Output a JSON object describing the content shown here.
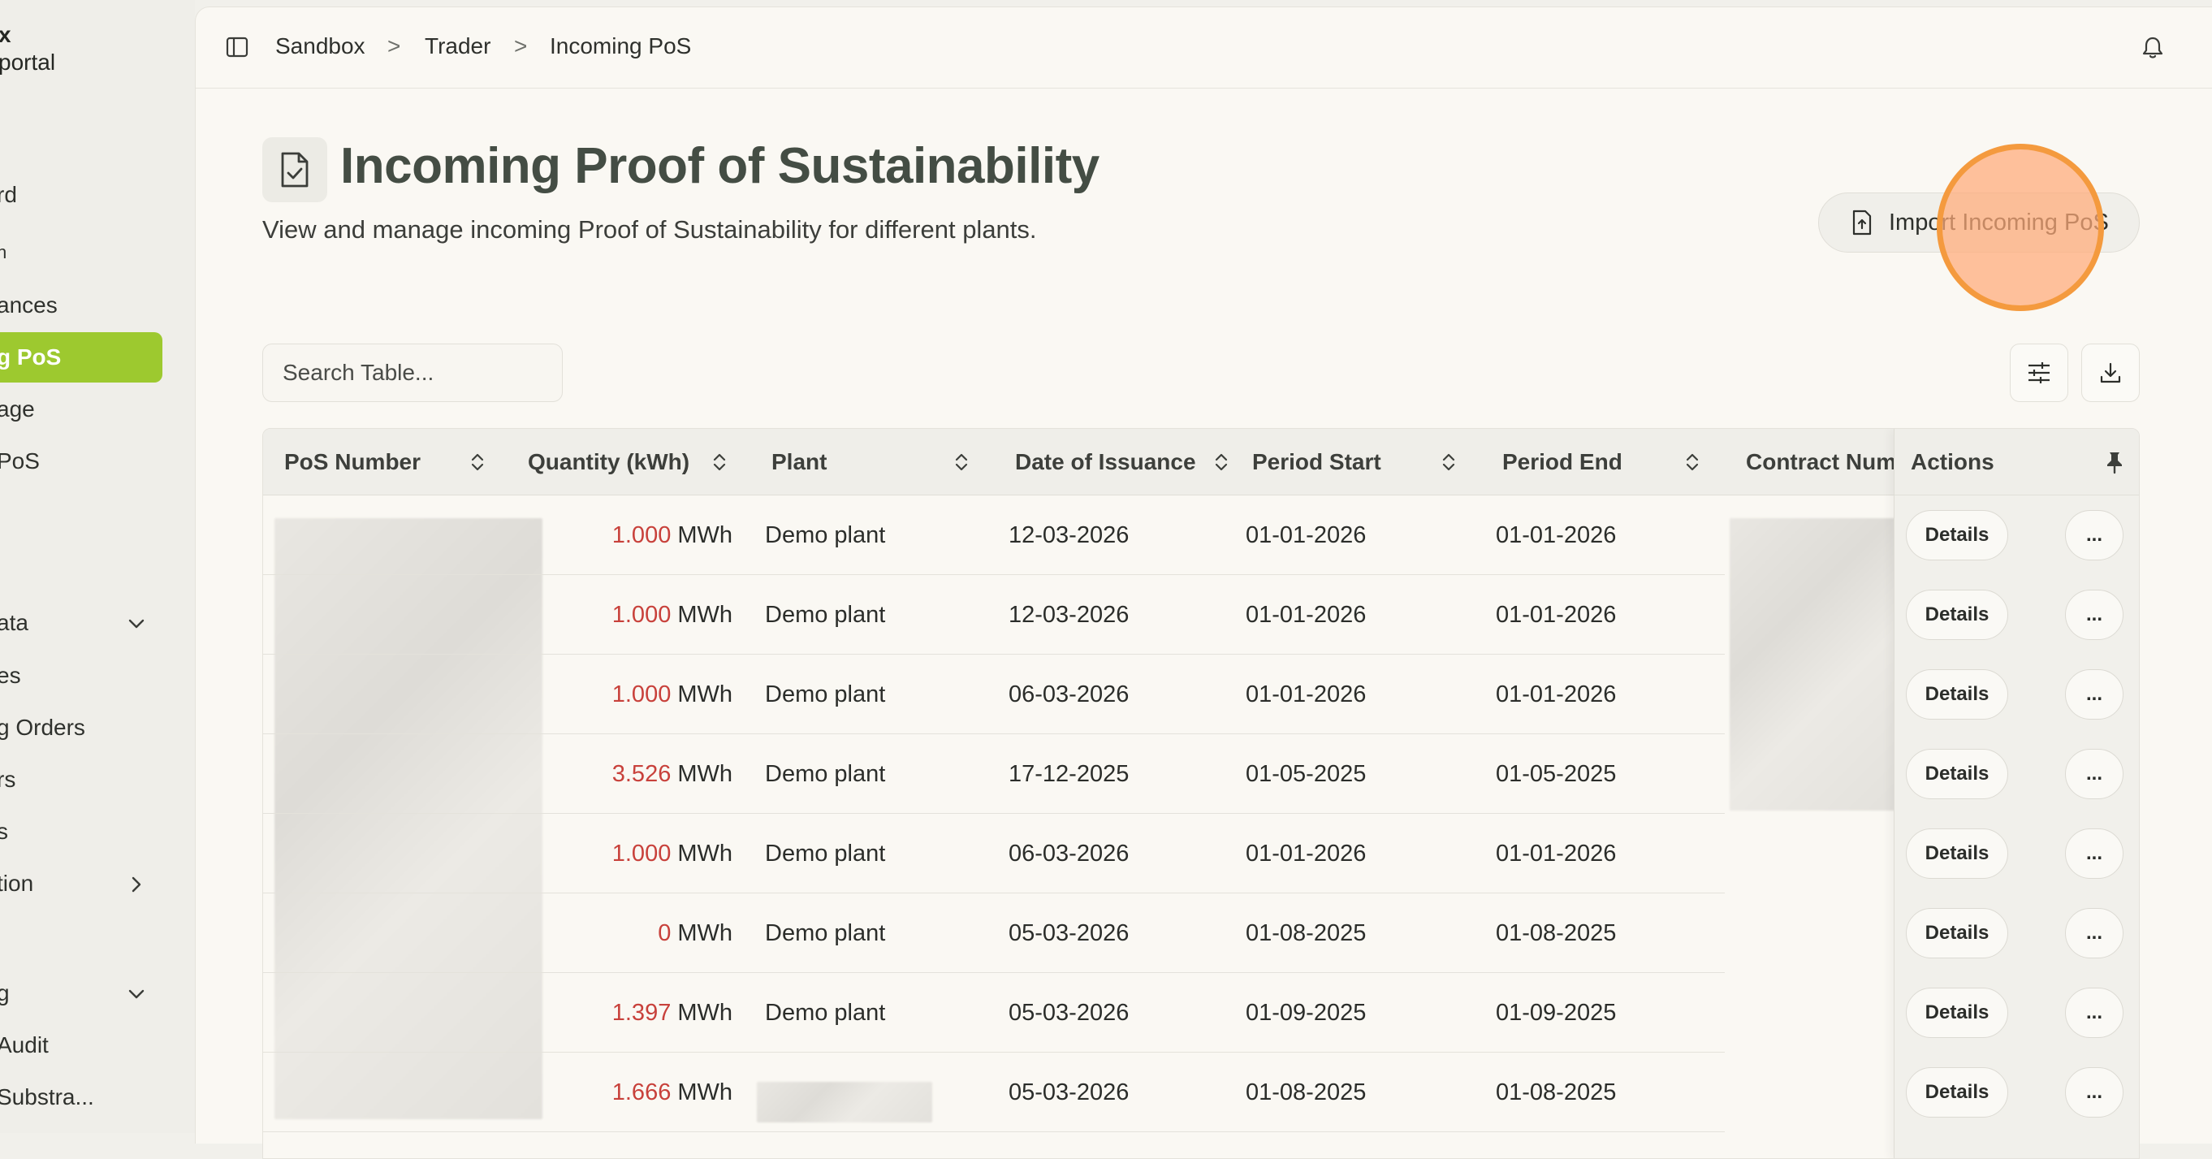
{
  "sidebar": {
    "brand_line1": "x",
    "brand_line2": "portal",
    "items": [
      {
        "label": "rd"
      },
      {
        "label": "n"
      },
      {
        "label": "ances"
      },
      {
        "label": "g PoS",
        "active": true
      },
      {
        "label": "age"
      },
      {
        "label": " PoS"
      },
      {
        "label": "ata"
      },
      {
        "label": "es"
      },
      {
        "label": "g Orders"
      },
      {
        "label": "rs"
      },
      {
        "label": "s"
      },
      {
        "label": "tion"
      },
      {
        "label": "g"
      },
      {
        "label": "Audit"
      },
      {
        "label": " Substra..."
      }
    ]
  },
  "breadcrumb": {
    "items": [
      "Sandbox",
      "Trader",
      "Incoming PoS"
    ],
    "separator": ">"
  },
  "header": {
    "title": "Incoming Proof of Sustainability",
    "subtitle": "View and manage incoming Proof of Sustainability for different plants.",
    "import_label": "Import Incoming PoS"
  },
  "search": {
    "placeholder": "Search Table..."
  },
  "table": {
    "columns": [
      "PoS Number",
      "Quantity (kWh)",
      "Plant",
      "Date of Issuance",
      "Period Start",
      "Period End",
      "Contract Num",
      "Actions"
    ],
    "unit": "MWh",
    "details_label": "Details",
    "more_label": "...",
    "rows": [
      {
        "quantity": "1.000",
        "plant": "Demo plant",
        "issued": "12-03-2026",
        "start": "01-01-2026",
        "end": "01-01-2026"
      },
      {
        "quantity": "1.000",
        "plant": "Demo plant",
        "issued": "12-03-2026",
        "start": "01-01-2026",
        "end": "01-01-2026"
      },
      {
        "quantity": "1.000",
        "plant": "Demo plant",
        "issued": "06-03-2026",
        "start": "01-01-2026",
        "end": "01-01-2026"
      },
      {
        "quantity": "3.526",
        "plant": "Demo plant",
        "issued": "17-12-2025",
        "start": "01-05-2025",
        "end": "01-05-2025"
      },
      {
        "quantity": "1.000",
        "plant": "Demo plant",
        "issued": "06-03-2026",
        "start": "01-01-2026",
        "end": "01-01-2026"
      },
      {
        "quantity": "0",
        "plant": "Demo plant",
        "issued": "05-03-2026",
        "start": "01-08-2025",
        "end": "01-08-2025"
      },
      {
        "quantity": "1.397",
        "plant": "Demo plant",
        "issued": "05-03-2026",
        "start": "01-09-2025",
        "end": "01-09-2025"
      },
      {
        "quantity": "1.666",
        "plant": "",
        "issued": "05-03-2026",
        "start": "01-08-2025",
        "end": "01-08-2025"
      }
    ]
  },
  "colors": {
    "accent": "#9dc92f",
    "quantity": "#c8413b",
    "cursor": "#f49a3e"
  }
}
